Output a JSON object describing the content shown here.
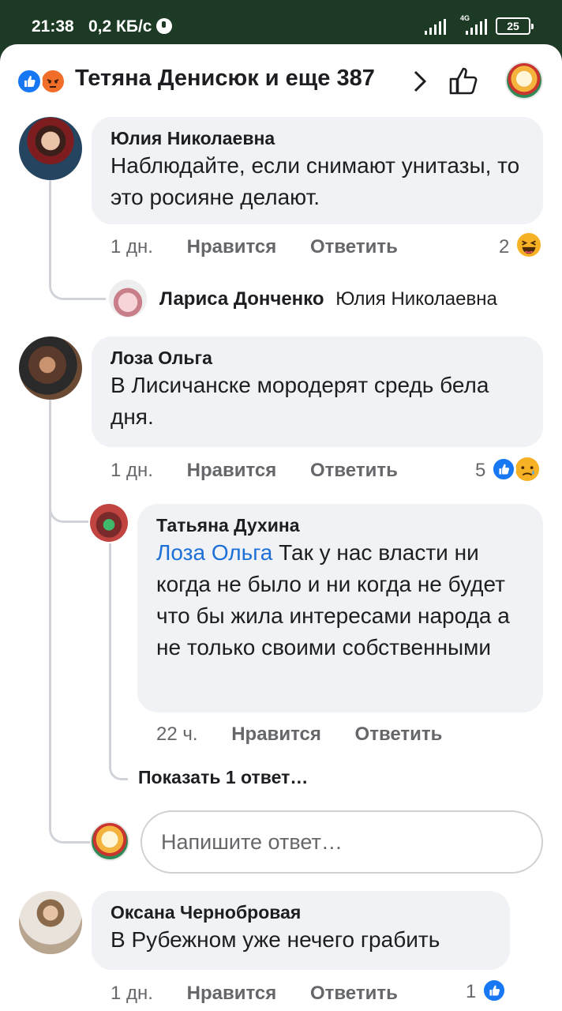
{
  "status_bar": {
    "time": "21:38",
    "speed": "0,2 КБ/с",
    "network": "4G",
    "battery": "25"
  },
  "header": {
    "title": "Тетяна Денисюк и еще 387",
    "reaction_icons": [
      "like-icon",
      "angry-icon"
    ],
    "colors": {
      "like": "#1877f2",
      "angry": "#f06d2a"
    }
  },
  "comments": [
    {
      "author": "Юлия Николаевна",
      "text": "Наблюдайте, если снимают унитазы, то это росияне делают.",
      "time": "1 дн.",
      "like_label": "Нравится",
      "reply_label": "Ответить",
      "reaction_count": "2",
      "reaction_icon": "haha-icon",
      "reply_preview": {
        "author": "Лариса Донченко",
        "to": "Юлия Николаевна"
      }
    },
    {
      "author": "Лоза Ольга",
      "text": "В Лисичанске мородерят  средь бела дня.",
      "time": "1 дн.",
      "like_label": "Нравится",
      "reply_label": "Ответить",
      "reaction_count": "5",
      "reaction_icons": [
        "like-icon",
        "sad-icon"
      ],
      "replies": [
        {
          "author": "Татьяна Духина",
          "mention": "Лоза Ольга",
          "text": "Так у нас власти ни когда не было и ни когда не будет что бы жила интересами народа а не только своими собственными",
          "time": "22 ч.",
          "like_label": "Нравится",
          "reply_label": "Ответить"
        }
      ],
      "show_more": "Показать 1 ответ…",
      "reply_placeholder": "Напишите ответ…"
    },
    {
      "author": "Оксана Чернобровая",
      "text": "В Рубежном уже нечего грабить",
      "time": "1 дн.",
      "like_label": "Нравится",
      "reply_label": "Ответить",
      "reaction_count": "1",
      "reaction_icon": "like-icon"
    }
  ]
}
